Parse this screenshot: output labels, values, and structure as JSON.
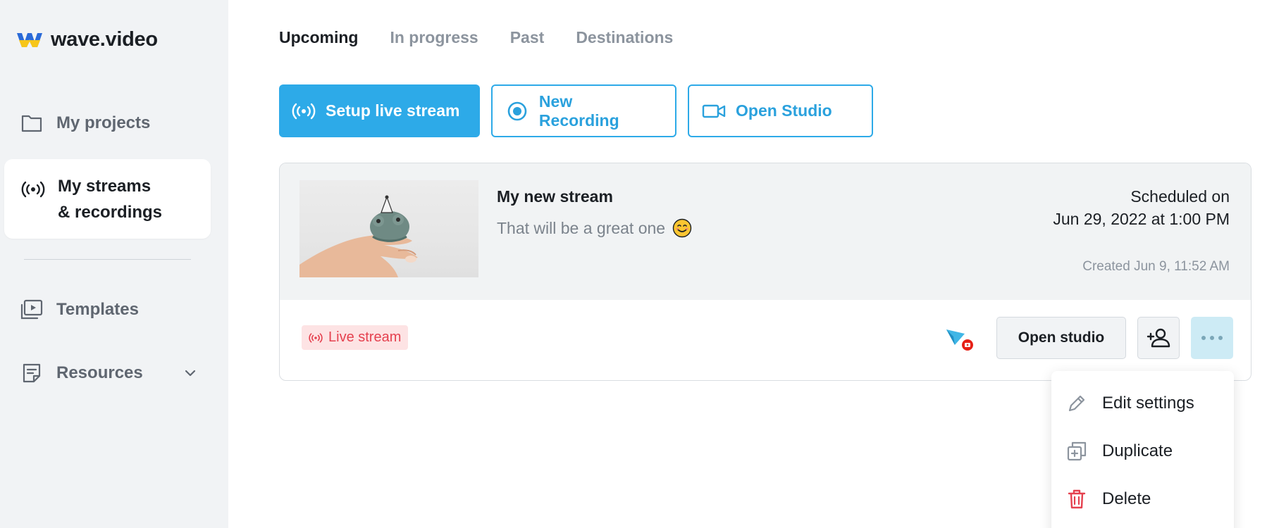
{
  "brand": {
    "name": "wave.video"
  },
  "sidebar": {
    "items": [
      {
        "label": "My projects",
        "icon": "folder-icon"
      },
      {
        "label_line1": "My streams",
        "label_line2": "& recordings",
        "icon": "broadcast-icon",
        "active": true
      },
      {
        "label": "Templates",
        "icon": "templates-icon"
      },
      {
        "label": "Resources",
        "icon": "document-icon",
        "has_dropdown": true
      }
    ]
  },
  "tabs": [
    {
      "label": "Upcoming",
      "active": true
    },
    {
      "label": "In progress"
    },
    {
      "label": "Past"
    },
    {
      "label": "Destinations"
    }
  ],
  "actions": {
    "setup_live": "Setup live stream",
    "new_recording": "New Recording",
    "open_studio": "Open Studio"
  },
  "stream_card": {
    "title": "My new stream",
    "description": "That will be a great one",
    "scheduled_label": "Scheduled on",
    "scheduled_date": "Jun 29, 2022 at 1:00 PM",
    "created": "Created Jun 9, 11:52 AM",
    "badge": "Live stream",
    "open_studio_label": "Open studio"
  },
  "menu": {
    "items": [
      {
        "label": "Edit settings",
        "icon": "pencil-icon"
      },
      {
        "label": "Duplicate",
        "icon": "duplicate-icon"
      },
      {
        "label": "Delete",
        "icon": "trash-icon"
      }
    ]
  },
  "colors": {
    "accent": "#2daae8",
    "danger": "#e5414f",
    "sidebar_bg": "#f1f3f5"
  }
}
